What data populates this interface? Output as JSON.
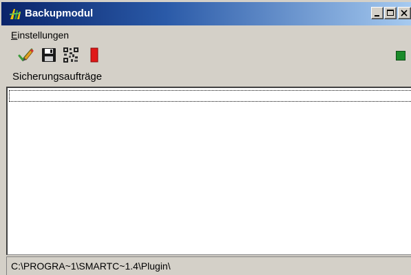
{
  "window": {
    "title": "Backupmodul",
    "accent_color": "#0a246a"
  },
  "menu": {
    "items": [
      {
        "label": "Einstellungen",
        "mnemonic": "E"
      }
    ]
  },
  "toolbar": {
    "icons": [
      "edit-pencil-icon",
      "save-disk-icon",
      "qr-code-icon",
      "stop-icon"
    ],
    "status_led_color": "#1a8a2a"
  },
  "section": {
    "label": "Sicherungsaufträge"
  },
  "jobs_list": {
    "items": []
  },
  "statusbar": {
    "path": "C:\\PROGRA~1\\SMARTC~1.4\\Plugin\\"
  }
}
